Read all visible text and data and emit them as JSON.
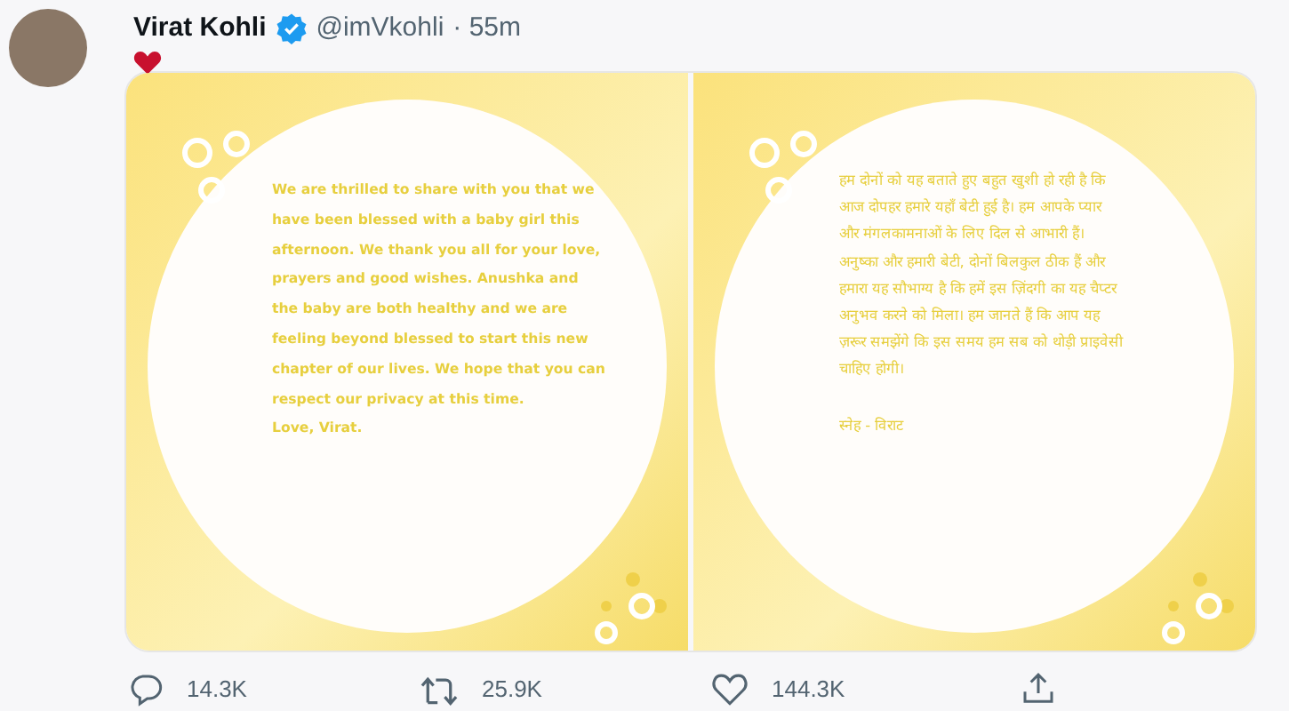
{
  "tweet": {
    "author": {
      "name": "Virat Kohli",
      "verified": true,
      "handle": "@imVkohli",
      "time": "· 55m"
    },
    "images": [
      {
        "kind": "english",
        "lines": [
          "We are thrilled to share with you that we",
          "have been blessed with a baby girl this",
          "afternoon. We thank you all for your love,",
          "prayers and good wishes. Anushka and",
          "the baby are both healthy and we are",
          "feeling beyond blessed to start this new",
          "chapter of our lives. We hope that you can",
          "respect our privacy at this time.",
          "Love, Virat."
        ]
      },
      {
        "kind": "hindi",
        "lines": [
          "हम दोनों को यह बताते हुए बहुत खुशी हो रही है कि",
          "आज दोपहर हमारे यहाँ बेटी हुई है। हम आपके प्यार",
          "और मंगलकामनाओं के लिए दिल से आभारी हैं।",
          "अनुष्का और हमारी बेटी, दोनों बिलकुल ठीक हैं और",
          "हमारा यह सौभाग्य है कि हमें इस ज़िंदगी का यह चैप्टर",
          "अनुभव करने को मिला। हम जानते हैं कि आप यह",
          "ज़रूर समझेंगे कि इस समय हम सब को थोड़ी प्राइवेसी",
          "चाहिए होगी।"
        ],
        "signoff": "स्नेह - विराट"
      }
    ],
    "actions": [
      {
        "kind": "reply",
        "count": "14.3K"
      },
      {
        "kind": "retweet",
        "count": "25.9K"
      },
      {
        "kind": "like",
        "count": "144.3K"
      },
      {
        "kind": "share"
      }
    ]
  }
}
